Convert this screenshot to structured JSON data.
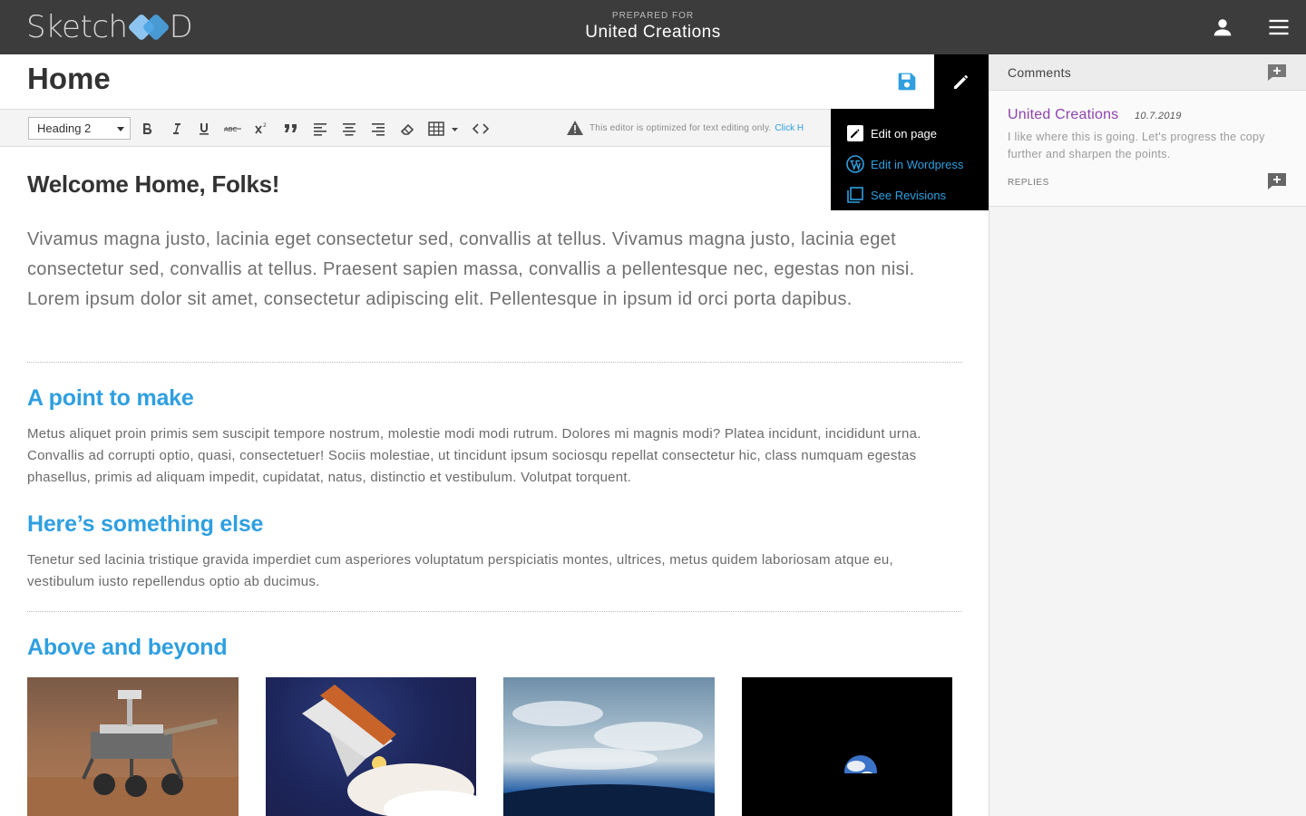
{
  "header": {
    "logo_text_a": "Sketch",
    "logo_text_b": "D",
    "prepared_label": "PREPARED FOR",
    "client_name": "United Creations",
    "user_icon": "person-icon",
    "menu_icon": "hamburger-menu-icon"
  },
  "page": {
    "title": "Home",
    "save_icon": "floppy-disk-icon",
    "edit_icon": "pencil-icon"
  },
  "toolbar": {
    "format_select": "Heading 2",
    "buttons": [
      "bold",
      "italic",
      "underline",
      "strikethrough",
      "superscript",
      "blockquote",
      "align-left",
      "align-center",
      "align-right",
      "clear-format",
      "table",
      "source-code"
    ],
    "notice_text": "This editor is optimized for text editing only.",
    "notice_link": "Click H"
  },
  "edit_menu": {
    "items": [
      {
        "label": "Edit on page",
        "icon": "pencil-square-icon",
        "color": "#ffffff"
      },
      {
        "label": "Edit in Wordpress",
        "icon": "wordpress-icon",
        "color": "#2e9fe0"
      },
      {
        "label": "See Revisions",
        "icon": "copy-stack-icon",
        "color": "#2e9fe0"
      }
    ]
  },
  "content": {
    "main_heading": "Welcome Home, Folks!",
    "lead": "Vivamus magna justo, lacinia eget consectetur sed, convallis at tellus. Vivamus magna justo, lacinia eget consectetur sed, convallis at tellus. Praesent sapien massa, convallis a pellentesque nec, egestas non nisi. Lorem ipsum dolor sit amet, consectetur adipiscing elit. Pellentesque in ipsum id orci porta dapibus.",
    "sections": [
      {
        "heading": "A point to make",
        "body": "Metus aliquet proin primis sem suscipit tempore nostrum, molestie modi modi rutrum. Dolores mi magnis modi? Platea incidunt, incididunt urna. Convallis ad corrupti optio, quasi, consectetuer! Sociis molestiae, ut tincidunt ipsum sociosqu repellat consectetur hic, class numquam egestas phasellus, primis ad aliquam impedit, cupidatat, natus, distinctio et vestibulum. Volutpat torquent."
      },
      {
        "heading": "Here’s something else",
        "body": "Tenetur sed lacinia tristique gravida imperdiet cum asperiores voluptatum perspiciatis montes, ultrices, metus quidem laboriosam atque eu, vestibulum iusto repellendus optio ab ducimus."
      },
      {
        "heading": "Above and beyond",
        "images": [
          "mars-rover-image",
          "space-shuttle-launch-image",
          "earth-atmosphere-image",
          "earth-from-space-image"
        ]
      }
    ]
  },
  "sidebar": {
    "title": "Comments",
    "add_icon": "add-comment-icon",
    "comments": [
      {
        "author": "United Creations",
        "date": "10.7.2019",
        "body": "I like where this is going. Let's progress the copy further and sharpen the points.",
        "replies_label": "REPLIES",
        "reply_icon": "add-reply-icon"
      }
    ]
  },
  "colors": {
    "topbar_bg": "#3c3c3c",
    "accent_blue": "#2f9fe0",
    "author_purple": "#8e44ad",
    "sidebar_bg": "#f4f4f4"
  }
}
